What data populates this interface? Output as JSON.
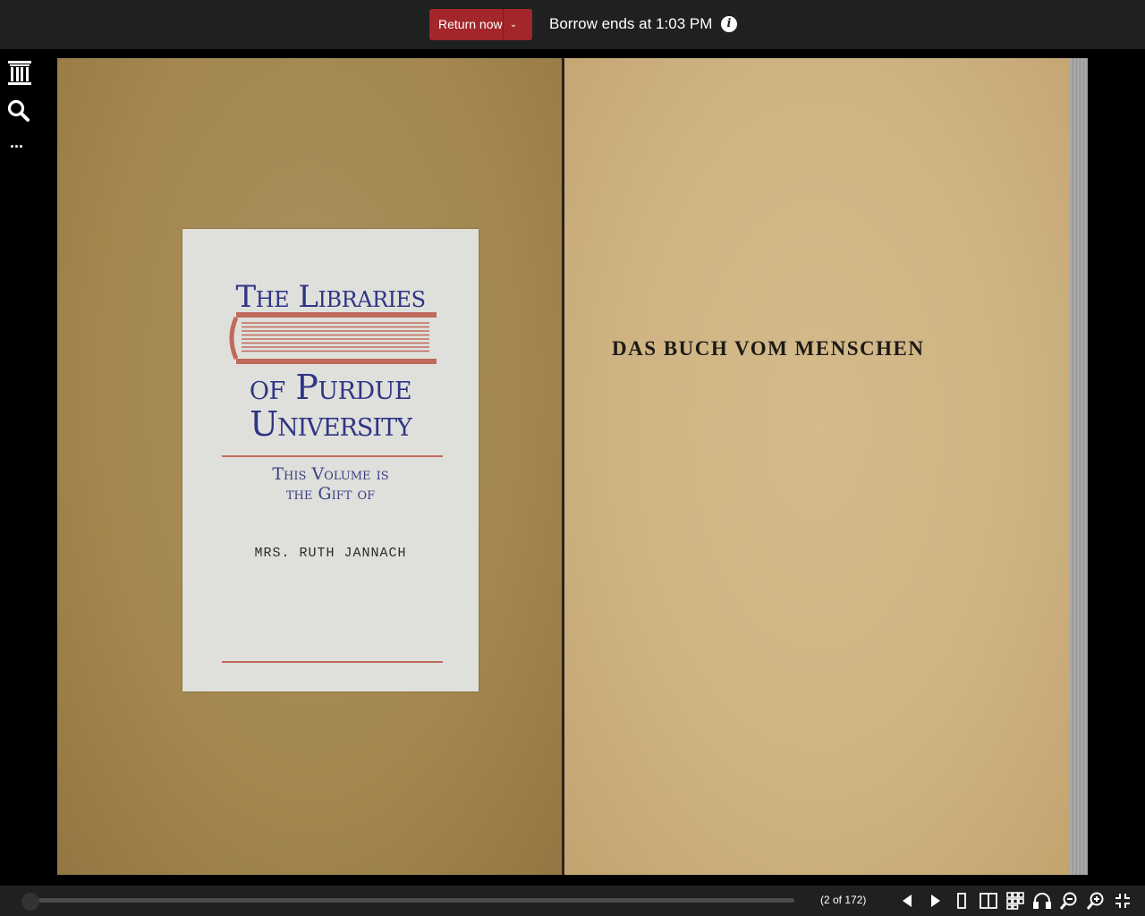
{
  "header": {
    "return_label": "Return now",
    "return_caret": "⌄",
    "borrow_text": "Borrow ends at 1:03 PM",
    "info_glyph": "i"
  },
  "sidebar": {
    "icons": [
      "library-icon",
      "search-icon",
      "more-icon"
    ],
    "more_glyph": "..."
  },
  "book": {
    "bookplate": {
      "line1": "The Libraries",
      "line2": "of Purdue",
      "line3": "University",
      "gift_line1": "This Volume is",
      "gift_line2": "the Gift of",
      "donor": "MRS. RUTH JANNACH"
    },
    "right_page_title": "DAS BUCH VOM MENSCHEN"
  },
  "footer": {
    "page_indicator": "(2 of 172)",
    "progress_fraction": 0.0116
  },
  "colors": {
    "accent": "#a3262a",
    "plate_ink": "#2f3584",
    "plate_rule": "#c06a5c"
  }
}
